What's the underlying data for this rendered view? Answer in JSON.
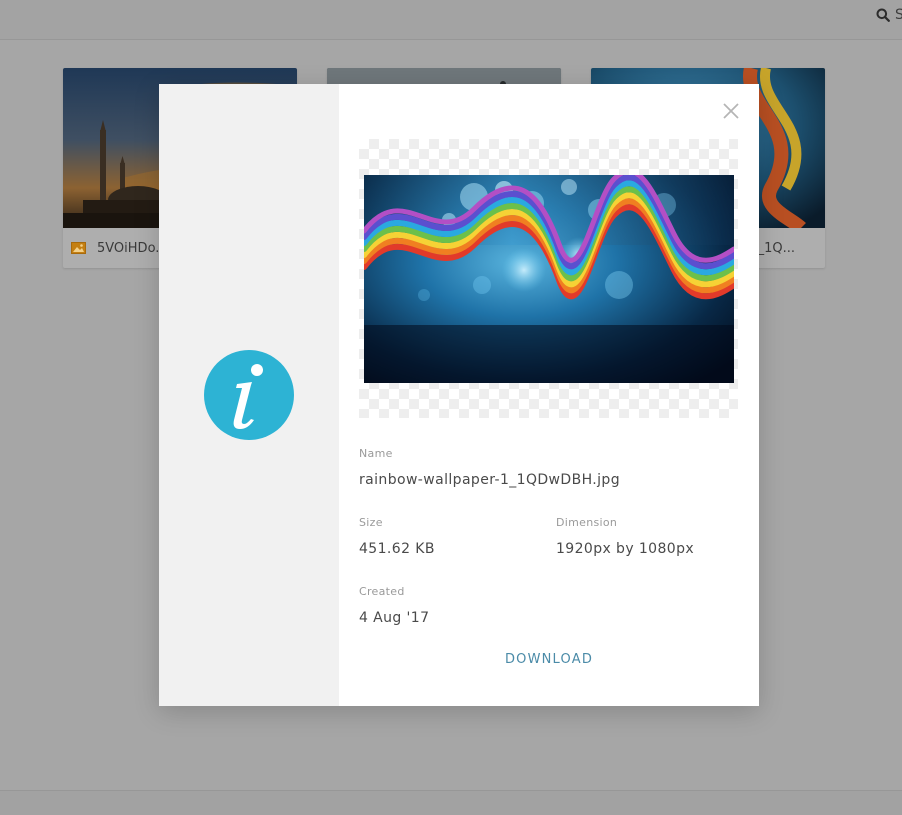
{
  "topbar": {
    "search_icon": "search-icon",
    "search_label": "S"
  },
  "gallery": {
    "cards": [
      {
        "file_name": "5VOiHDo...",
        "file_icon": "image-file-icon"
      },
      {
        "file_name": ""
      },
      {
        "file_name": "_1Q..."
      }
    ]
  },
  "modal": {
    "side_icon": "info-icon",
    "close_icon": "close-icon",
    "colors": {
      "accent": "#2db3d4",
      "link": "#4b8ba8",
      "side_panel": "#f1f1f1"
    },
    "fields": {
      "name_label": "Name",
      "name_value": "rainbow-wallpaper-1_1QDwDBH.jpg",
      "size_label": "Size",
      "size_value": "451.62 KB",
      "dimension_label": "Dimension",
      "dimension_value": "1920px by 1080px",
      "created_label": "Created",
      "created_value": "4 Aug '17"
    },
    "download_label": "DOWNLOAD"
  }
}
